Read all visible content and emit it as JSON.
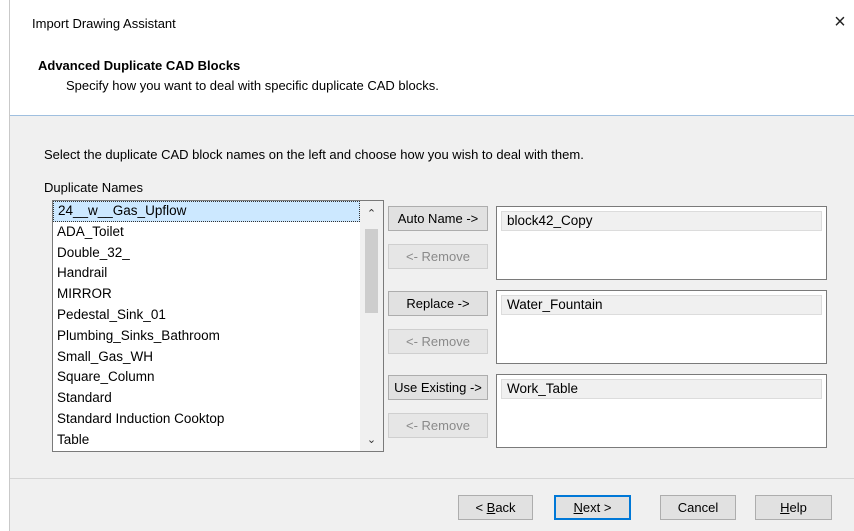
{
  "window": {
    "title": "Import Drawing Assistant",
    "close_glyph": "×"
  },
  "header": {
    "title": "Advanced Duplicate CAD Blocks",
    "subtitle": "Specify how you want to deal with specific duplicate CAD blocks."
  },
  "instructions": "Select the duplicate CAD block names on the left and choose how you wish to deal with them.",
  "duplicate_names": {
    "label": "Duplicate Names",
    "selected_index": 0,
    "items": [
      "24__w__Gas_Upflow",
      "ADA_Toilet",
      "Double_32_",
      "Handrail",
      "MIRROR",
      "Pedestal_Sink_01",
      "Plumbing_Sinks_Bathroom",
      "Small_Gas_WH",
      "Square_Column",
      "Standard",
      "Standard Induction Cooktop",
      "Table"
    ]
  },
  "actions": {
    "auto_name": {
      "button": "Auto Name ->",
      "remove": "<- Remove",
      "value": "block42_Copy"
    },
    "replace": {
      "button": "Replace ->",
      "remove": "<- Remove",
      "value": "Water_Fountain"
    },
    "use_existing": {
      "button": "Use Existing ->",
      "remove": "<- Remove",
      "value": "Work_Table"
    }
  },
  "footer": {
    "back_mnemonic": "B",
    "back_rest": "ack",
    "back_prefix": "< ",
    "next_mnemonic": "N",
    "next_rest": "ext >",
    "cancel": "Cancel",
    "help_mnemonic": "H",
    "help_rest": "elp"
  },
  "icons": {
    "scroll_up": "chevron-up-icon",
    "scroll_down": "chevron-down-icon",
    "close": "close-icon"
  },
  "colors": {
    "selection": "#cce8ff",
    "accent": "#0078d7",
    "divider": "#9fbfdf"
  }
}
